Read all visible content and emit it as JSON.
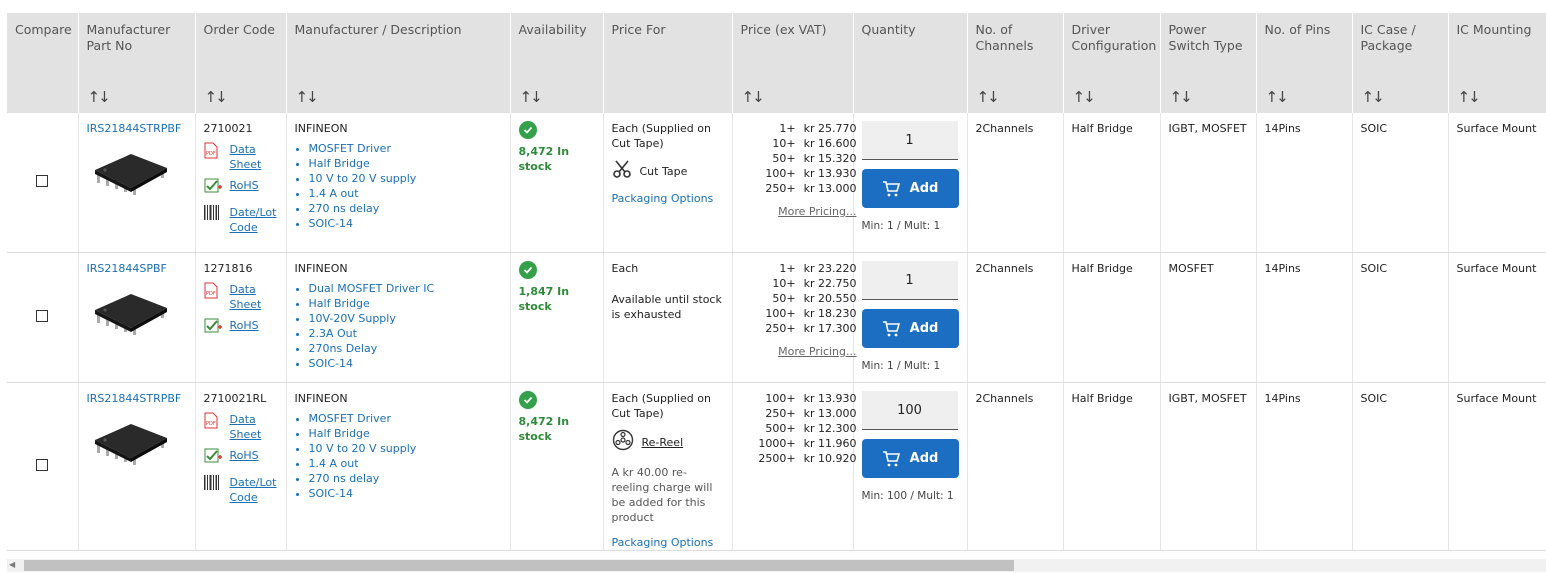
{
  "headers": {
    "compare": "Compare",
    "mpn": "Manufacturer Part No",
    "order_code": "Order Code",
    "mfr_desc": "Manufacturer / Description",
    "availability": "Availability",
    "price_for": "Price For",
    "price": "Price (ex VAT)",
    "quantity": "Quantity",
    "channels": "No. of Channels",
    "driver_config": "Driver Configuration",
    "power_switch": "Power Switch Type",
    "pins": "No. of Pins",
    "ic_case": "IC Case / Package",
    "ic_mounting": "IC Mounting",
    "sort_icon": "↑↓"
  },
  "labels": {
    "data_sheet": "Data Sheet",
    "rohs": "RoHS",
    "date_lot": "Date/Lot Code",
    "add": "Add",
    "packaging_options": "Packaging Options",
    "more_pricing": "More Pricing..."
  },
  "rows": [
    {
      "mpn": "IRS21844STRPBF",
      "order_code": "2710021",
      "manufacturer": "INFINEON",
      "features": [
        "MOSFET Driver",
        "Half Bridge",
        "10 V to 20 V supply",
        "1.4 A out",
        "270 ns delay",
        "SOIC-14"
      ],
      "stock": "8,472 In stock",
      "price_for": "Each (Supplied on Cut Tape)",
      "packaging": "Cut Tape",
      "prices": [
        {
          "q": "1+",
          "p": "kr 25.770"
        },
        {
          "q": "10+",
          "p": "kr 16.600"
        },
        {
          "q": "50+",
          "p": "kr 15.320"
        },
        {
          "q": "100+",
          "p": "kr 13.930"
        },
        {
          "q": "250+",
          "p": "kr 13.000"
        }
      ],
      "qty": "1",
      "minmult": "Min: 1 / Mult: 1",
      "channels": "2Channels",
      "driver_config": "Half Bridge",
      "power_switch": "IGBT, MOSFET",
      "pins": "14Pins",
      "ic_case": "SOIC",
      "ic_mounting": "Surface Mount"
    },
    {
      "mpn": "IRS21844SPBF",
      "order_code": "1271816",
      "manufacturer": "INFINEON",
      "features": [
        "Dual MOSFET Driver IC",
        "Half Bridge",
        "10V-20V Supply",
        "2.3A Out",
        "270ns Delay",
        "SOIC-14"
      ],
      "stock": "1,847 In stock",
      "price_for": "Each",
      "availability_note": "Available until stock is exhausted",
      "prices": [
        {
          "q": "1+",
          "p": "kr 23.220"
        },
        {
          "q": "10+",
          "p": "kr 22.750"
        },
        {
          "q": "50+",
          "p": "kr 20.550"
        },
        {
          "q": "100+",
          "p": "kr 18.230"
        },
        {
          "q": "250+",
          "p": "kr 17.300"
        }
      ],
      "qty": "1",
      "minmult": "Min: 1 / Mult: 1",
      "channels": "2Channels",
      "driver_config": "Half Bridge",
      "power_switch": "MOSFET",
      "pins": "14Pins",
      "ic_case": "SOIC",
      "ic_mounting": "Surface Mount"
    },
    {
      "mpn": "IRS21844STRPBF",
      "order_code": "2710021RL",
      "manufacturer": "INFINEON",
      "features": [
        "MOSFET Driver",
        "Half Bridge",
        "10 V to 20 V supply",
        "1.4 A out",
        "270 ns delay",
        "SOIC-14"
      ],
      "stock": "8,472 In stock",
      "price_for": "Each (Supplied on Cut Tape)",
      "packaging": "Re-Reel",
      "reel_note": "A kr 40.00 re-reeling charge will be added for this product",
      "prices": [
        {
          "q": "100+",
          "p": "kr 13.930"
        },
        {
          "q": "250+",
          "p": "kr 13.000"
        },
        {
          "q": "500+",
          "p": "kr 12.300"
        },
        {
          "q": "1000+",
          "p": "kr 11.960"
        },
        {
          "q": "2500+",
          "p": "kr 10.920"
        }
      ],
      "qty": "100",
      "minmult": "Min: 100 / Mult: 1",
      "channels": "2Channels",
      "driver_config": "Half Bridge",
      "power_switch": "IGBT, MOSFET",
      "pins": "14Pins",
      "ic_case": "SOIC",
      "ic_mounting": "Surface Mount"
    }
  ],
  "colors": {
    "header_bg": "#e2e2e2",
    "link": "#1a6fb5",
    "stock_green": "#2e8b3a",
    "add_button": "#1b6ec2"
  }
}
